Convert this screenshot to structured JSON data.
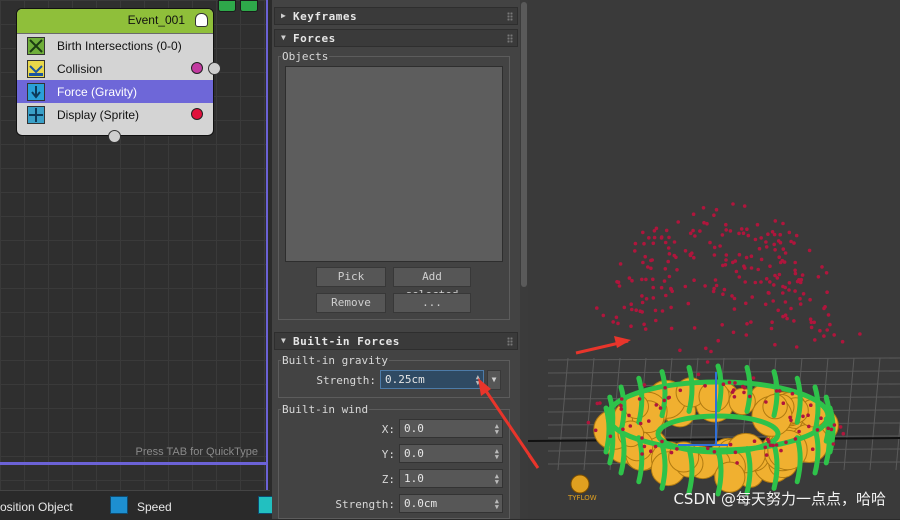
{
  "node_editor": {
    "event_title": "Event_001",
    "operators": [
      {
        "label": "Birth Intersections (0-0)",
        "icon": "birth-intersections-icon"
      },
      {
        "label": "Collision",
        "icon": "collision-icon"
      },
      {
        "label": "Force (Gravity)",
        "icon": "force-icon"
      },
      {
        "label": "Display (Sprite)",
        "icon": "display-icon"
      }
    ],
    "quicktype_hint": "Press TAB for QuickType",
    "bottom_items": [
      "osition Object",
      "Speed"
    ],
    "colors": {
      "accent": "#6e67d8",
      "header": "#8fbf3a",
      "collision_dot": "#c23aa0",
      "display_dot": "#e0103c"
    }
  },
  "panel": {
    "keyframes_title": "Keyframes",
    "forces_title": "Forces",
    "objects_label": "Objects",
    "pick_label": "Pick",
    "add_selected_label": "Add selected",
    "remove_label": "Remove",
    "more_label": "...",
    "builtin_title": "Built-in Forces",
    "gravity_group": "Built-in gravity",
    "strength_label": "Strength:",
    "gravity_strength": "0.25cm",
    "wind_group": "Built-in wind",
    "x_label": "X:",
    "x_value": "0.0",
    "y_label": "Y:",
    "y_value": "0.0",
    "z_label": "Z:",
    "z_value": "1.0",
    "wind_strength_label": "Strength:",
    "wind_strength": "0.0cm"
  },
  "viewport": {
    "watermark": "CSDN @每天努力一点点，哈哈",
    "gizmo_text": "TYFLOW",
    "colors": {
      "particles": "#b0153c",
      "spheres": "#f0b030",
      "mesh": "#2ec24a",
      "arrow": "#e8352b"
    }
  }
}
